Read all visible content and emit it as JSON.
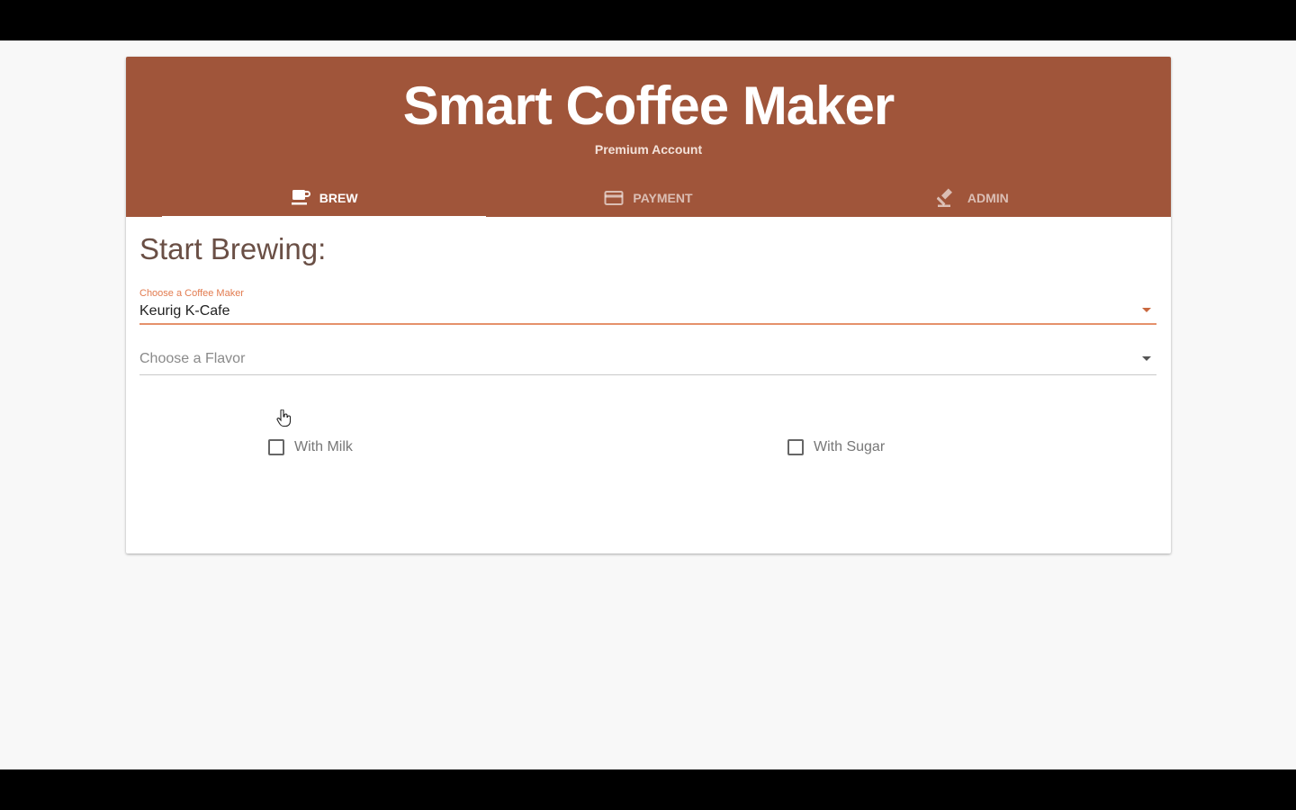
{
  "app": {
    "title": "Smart Coffee Maker",
    "subtitle": "Premium Account",
    "brand_color": "#a0553a"
  },
  "tabs": [
    {
      "label": "BREW",
      "icon": "coffee-cup-icon",
      "active": true
    },
    {
      "label": "PAYMENT",
      "icon": "credit-card-icon",
      "active": false
    },
    {
      "label": "ADMIN",
      "icon": "gavel-icon",
      "active": false
    }
  ],
  "main": {
    "title": "Start Brewing:",
    "coffee_maker": {
      "label": "Choose a Coffee Maker",
      "value": "Keurig K-Cafe"
    },
    "flavor": {
      "placeholder": "Choose a Flavor",
      "value": ""
    },
    "options": {
      "milk_label": "With Milk",
      "milk_checked": false,
      "sugar_label": "With Sugar",
      "sugar_checked": false
    }
  },
  "colors": {
    "accent": "#e27b4f",
    "tab_inactive": "#e0b6a4"
  }
}
